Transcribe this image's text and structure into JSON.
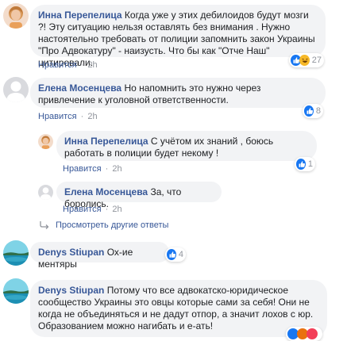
{
  "colors": {
    "link": "#385898",
    "bubble": "#f2f3f5",
    "meta": "#90949c",
    "like_blue": "#1877f2",
    "haha_yellow": "#f7b928",
    "angry_orange": "#e9710f",
    "love_red": "#f33e58"
  },
  "comments": [
    {
      "author": "Инна Перепелица",
      "text": "Когда уже у этих дебилоидов будут мозги ?! Эту ситуацию нельзя оставлять без внимания . Нужно настоятельно требовать от полиции запомнить закон Украины \"Про Адвокатуру\" - наизусть. Что бы как \"Отче Наш\" цитировали.",
      "like_label": "Нравится",
      "time": "2h",
      "reactions": [
        "like-icon",
        "haha-icon"
      ],
      "reaction_count": "27"
    },
    {
      "author": "Елена Мосенцева",
      "text": "Но напомнить это нужно через привлечение к уголовной ответственности.",
      "like_label": "Нравится",
      "time": "2h",
      "reactions": [
        "like-icon"
      ],
      "reaction_count": "8",
      "replies": [
        {
          "author": "Инна Перепелица",
          "text": "С учётом их знаний , боюсь работать в полиции будет некому !",
          "like_label": "Нравится",
          "time": "2h",
          "reactions": [
            "like-icon"
          ],
          "reaction_count": "1"
        },
        {
          "author": "Елена Мосенцева",
          "text": "За, что боролись.",
          "like_label": "Нравится",
          "time": "2h"
        }
      ],
      "more_replies_label": "Просмотреть другие ответы"
    },
    {
      "author": "Denys Stiupan",
      "text": "Ох-ие ментяры",
      "reactions": [
        "like-icon"
      ],
      "reaction_count": "4"
    },
    {
      "author": "Denys Stiupan",
      "text": "Потому что все адвокатско-юридическое сообщество Украины это овцы которые сами за себя! Они не когда не объединяться и не дадут отпор, а значит лохов с юр. Образованием можно нагибать и е-ать!",
      "reactions": [
        "like-icon",
        "angry-icon",
        "love-icon"
      ]
    }
  ]
}
